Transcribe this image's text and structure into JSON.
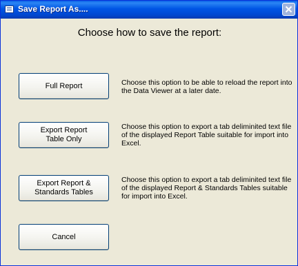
{
  "window": {
    "title": "Save Report As....",
    "heading": "Choose how to save the report:"
  },
  "options": [
    {
      "button_line1": "Full Report",
      "button_line2": "",
      "description": "Choose this option to be able to reload the report into the Data Viewer at a later date."
    },
    {
      "button_line1": "Export Report",
      "button_line2": "Table Only",
      "description": "Choose this option to export a tab deliminited text file of the displayed Report Table suitable for import into Excel."
    },
    {
      "button_line1": "Export Report &",
      "button_line2": "Standards Tables",
      "description": "Choose this option to export a tab deliminited text file of the displayed Report  & Standards Tables suitable for import into Excel."
    }
  ],
  "cancel_label": "Cancel",
  "icons": {
    "app": "app-icon",
    "close": "close-icon"
  }
}
